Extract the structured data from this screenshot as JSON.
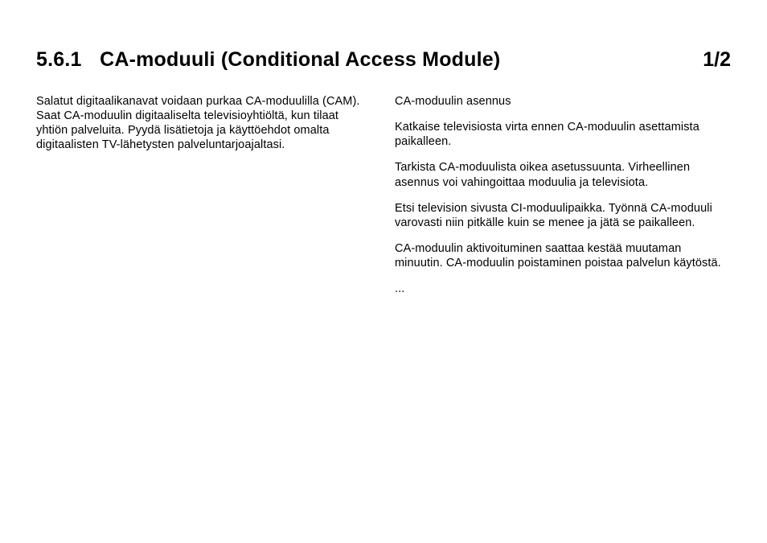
{
  "header": {
    "section_number": "5.6.1",
    "title": "CA-moduuli (Conditional Access Module)",
    "page_indicator": "1/2"
  },
  "left_column": {
    "p1": "Salatut digitaalikanavat voidaan purkaa CA-moduulilla (CAM). Saat CA-moduulin digitaaliselta televisioyhtiöltä, kun tilaat yhtiön palveluita. Pyydä lisätietoja ja käyttöehdot omalta digitaalisten TV-lähetysten palveluntarjoajaltasi."
  },
  "right_column": {
    "p1": "CA-moduulin asennus",
    "p2": "Katkaise televisiosta virta ennen CA-moduulin asettamista paikalleen.",
    "p3": "Tarkista CA-moduulista oikea asetussuunta. Virheellinen asennus voi vahingoittaa moduulia ja televisiota.",
    "p4": "Etsi television sivusta CI-moduulipaikka. Työnnä CA-moduuli varovasti niin pitkälle kuin se menee ja jätä se paikalleen.",
    "p5": "CA-moduulin aktivoituminen saattaa kestää muutaman minuutin. CA-moduulin poistaminen poistaa palvelun käytöstä.",
    "p6": "..."
  }
}
